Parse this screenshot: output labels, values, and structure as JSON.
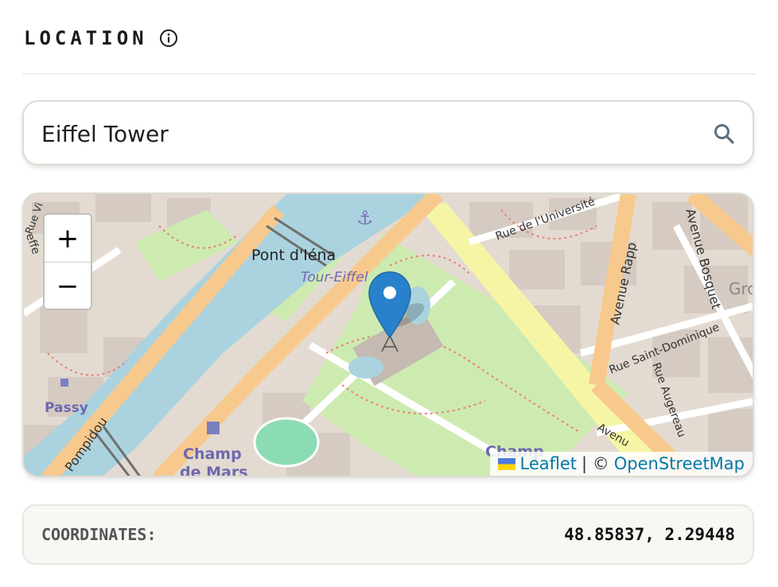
{
  "section": {
    "title": "LOCATION",
    "info_icon": "info-circle-icon"
  },
  "search": {
    "value": "Eiffel Tower",
    "placeholder": "",
    "icon": "search-icon"
  },
  "map": {
    "zoom_in_label": "+",
    "zoom_out_label": "−",
    "marker_icon": "map-pin-icon",
    "labels": {
      "bridge": "Pont d'Iéna",
      "station": "Tour-Eiffel",
      "passy": "Passy",
      "champ_de_mars_1": "Champ",
      "champ_de_mars_2": "de Mars",
      "champ_partial": "Champ",
      "pompidou": "Pompidou",
      "rue_universite": "Rue de l'Université",
      "avenue_rapp": "Avenue Rapp",
      "avenue_bosquet": "Avenue Bosquet",
      "rue_saint_dominique": "Rue Saint-Dominique",
      "rue_augereau": "Rue Augereau",
      "avenue_partial": "Avenu",
      "rue_vi": "Rue Vi",
      "effe": "effe",
      "gro": "Gro"
    },
    "colors": {
      "water": "#aad3df",
      "park": "#cdebb0",
      "road_major": "#f8c98d",
      "road_yellow": "#f6f5a5",
      "building": "#d9d0c9",
      "marker": "#2a81cb"
    },
    "attribution": {
      "flag": "ukraine-flag-icon",
      "leaflet": "Leaflet",
      "separator": "| ©",
      "osm": "OpenStreetMap"
    }
  },
  "coordinates": {
    "label": "COORDINATES:",
    "value": "48.85837, 2.29448"
  }
}
